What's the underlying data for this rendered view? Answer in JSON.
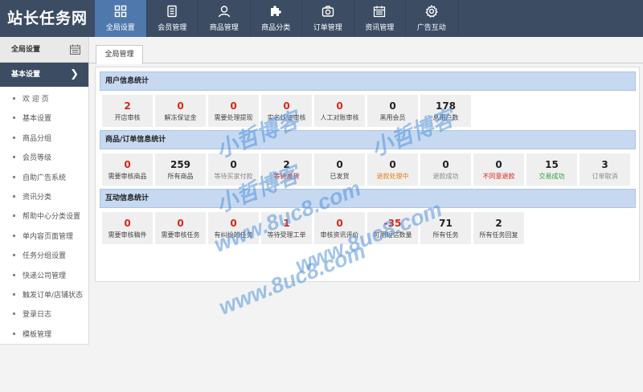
{
  "app": {
    "logo": "站长任务网"
  },
  "nav": [
    {
      "label": "全局设置",
      "icon": "grid-icon",
      "active": true
    },
    {
      "label": "会员管理",
      "icon": "document-icon",
      "active": false
    },
    {
      "label": "商品管理",
      "icon": "user-icon",
      "active": false
    },
    {
      "label": "商品分类",
      "icon": "puzzle-icon",
      "active": false
    },
    {
      "label": "订单管理",
      "icon": "camera-icon",
      "active": false
    },
    {
      "label": "资讯管理",
      "icon": "calendar-icon",
      "active": false
    },
    {
      "label": "广告互动",
      "icon": "gear-icon",
      "active": false
    }
  ],
  "sidebar": {
    "header": "全局设置",
    "header_icon": "calendar-icon",
    "section": "基本设置",
    "items": [
      {
        "label": "欢 迎 页"
      },
      {
        "label": "基本设置"
      },
      {
        "label": "商品分组"
      },
      {
        "label": "会员等级"
      },
      {
        "label": "自助广告系统"
      },
      {
        "label": "资讯分类"
      },
      {
        "label": "帮助中心分类设置"
      },
      {
        "label": "单内容页面管理"
      },
      {
        "label": "任务分组设置"
      },
      {
        "label": "快递公司管理"
      },
      {
        "label": "触发订单/店铺状态"
      },
      {
        "label": "登录日志"
      },
      {
        "label": "模板管理"
      }
    ]
  },
  "tabs": [
    {
      "label": "全局管理"
    }
  ],
  "sections": [
    {
      "title": "用户信息统计",
      "cards": [
        {
          "value": "2",
          "label": "开店审核",
          "value_color": "#d9261c",
          "label_color": "#444444"
        },
        {
          "value": "0",
          "label": "解冻保证金",
          "value_color": "#d9261c",
          "label_color": "#444444"
        },
        {
          "value": "0",
          "label": "需要处理提现",
          "value_color": "#d9261c",
          "label_color": "#444444"
        },
        {
          "value": "0",
          "label": "实名认证审核",
          "value_color": "#d9261c",
          "label_color": "#444444"
        },
        {
          "value": "0",
          "label": "人工对账审核",
          "value_color": "#d9261c",
          "label_color": "#444444"
        },
        {
          "value": "0",
          "label": "黑用会员",
          "value_color": "#222222",
          "label_color": "#444444"
        },
        {
          "value": "178",
          "label": "总用户数",
          "value_color": "#222222",
          "label_color": "#444444"
        }
      ]
    },
    {
      "title": "商品/订单信息统计",
      "cards": [
        {
          "value": "0",
          "label": "需要审核商品",
          "value_color": "#d9261c",
          "label_color": "#444444"
        },
        {
          "value": "259",
          "label": "所有商品",
          "value_color": "#222222",
          "label_color": "#444444"
        },
        {
          "value": "0",
          "label": "等待买家付款",
          "value_color": "#222222",
          "label_color": "#888888"
        },
        {
          "value": "2",
          "label": "等待发货",
          "value_color": "#222222",
          "label_color": "#d9261c"
        },
        {
          "value": "0",
          "label": "已发货",
          "value_color": "#222222",
          "label_color": "#444444"
        },
        {
          "value": "0",
          "label": "退款处理中",
          "value_color": "#222222",
          "label_color": "#e8791c"
        },
        {
          "value": "0",
          "label": "退款成功",
          "value_color": "#222222",
          "label_color": "#888888"
        },
        {
          "value": "0",
          "label": "不同意退款",
          "value_color": "#222222",
          "label_color": "#d9261c"
        },
        {
          "value": "15",
          "label": "交易成功",
          "value_color": "#222222",
          "label_color": "#2e9e3a"
        },
        {
          "value": "3",
          "label": "订单取消",
          "value_color": "#222222",
          "label_color": "#888888"
        }
      ]
    },
    {
      "title": "互动信息统计",
      "cards": [
        {
          "value": "0",
          "label": "需要审核稿件",
          "value_color": "#d9261c",
          "label_color": "#444444"
        },
        {
          "value": "0",
          "label": "需要审核任务",
          "value_color": "#d9261c",
          "label_color": "#444444"
        },
        {
          "value": "0",
          "label": "有纠纷的任务",
          "value_color": "#d9261c",
          "label_color": "#444444"
        },
        {
          "value": "1",
          "label": "等待受理工单",
          "value_color": "#d9261c",
          "label_color": "#444444"
        },
        {
          "value": "0",
          "label": "审核资讯评价",
          "value_color": "#d9261c",
          "label_color": "#444444"
        },
        {
          "value": "-35",
          "label": "可用短信数量",
          "value_color": "#d9261c",
          "label_color": "#444444"
        },
        {
          "value": "71",
          "label": "所有任务",
          "value_color": "#222222",
          "label_color": "#444444"
        },
        {
          "value": "2",
          "label": "所有任务回复",
          "value_color": "#222222",
          "label_color": "#444444"
        }
      ]
    }
  ],
  "watermark": [
    "小哲博客",
    "小哲博客",
    "小哲博客",
    "www.8uc8.com",
    "www.8uc8.com",
    "www.8uc8.com"
  ]
}
